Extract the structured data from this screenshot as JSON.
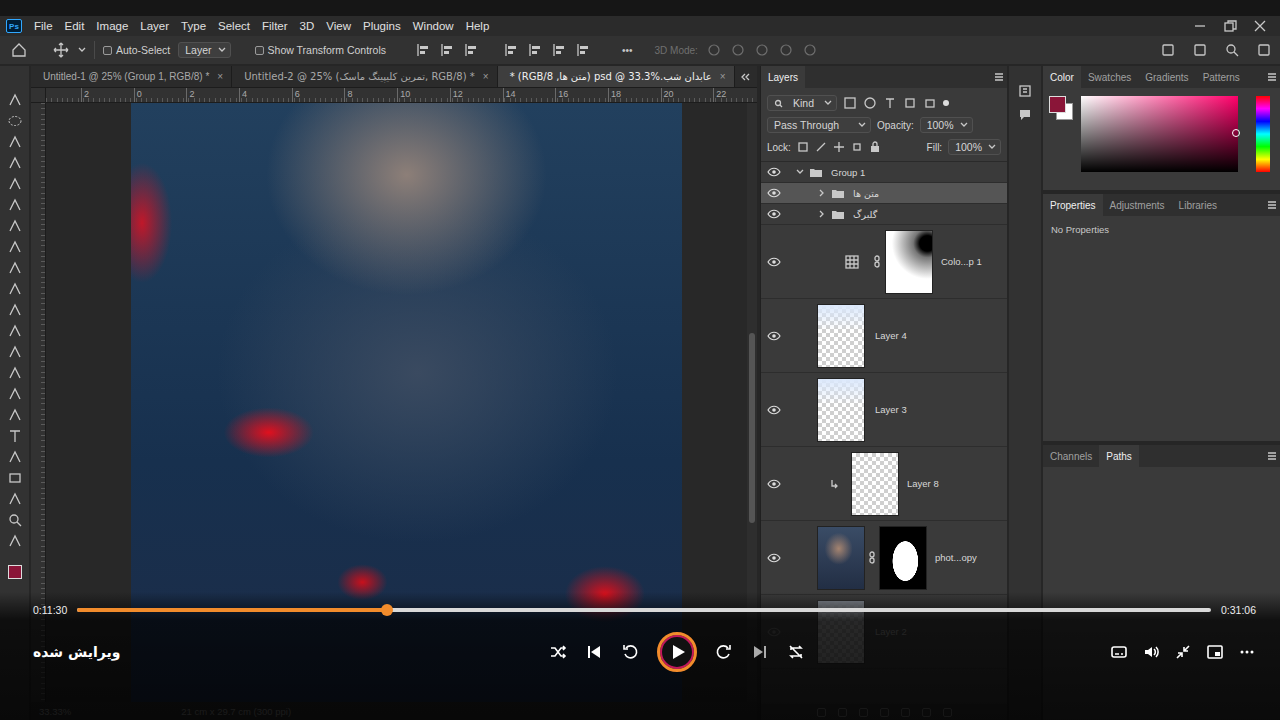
{
  "app": {
    "logo": "Ps"
  },
  "menu": [
    "File",
    "Edit",
    "Image",
    "Layer",
    "Type",
    "Select",
    "Filter",
    "3D",
    "View",
    "Plugins",
    "Window",
    "Help"
  ],
  "options": {
    "auto_select": {
      "label": "Auto-Select",
      "checked": false
    },
    "target": "Layer",
    "show_transform": {
      "label": "Show Transform Controls",
      "checked": false
    },
    "more": "•••",
    "mode_3d": "3D Mode:"
  },
  "tabs": [
    {
      "label": "Untitled-1 @ 25% (Group 1, RGB/8) *",
      "selected": false
    },
    {
      "label": "Untitled-2 @ 25% (تمرین کلیپینگ ماسک, RGB/8) *",
      "selected": false
    },
    {
      "label": "عابدان شب.psd @ 33.3% (متن ها, RGB/8) *",
      "selected": true
    }
  ],
  "tab_close": "×",
  "ruler": [
    "2",
    "0",
    "2",
    "4",
    "6",
    "8",
    "10",
    "12",
    "14",
    "16",
    "18",
    "20",
    "22"
  ],
  "layers_panel": {
    "title": "Layers",
    "filter": "Kind",
    "blend": "Pass Through",
    "opacity_label": "Opacity:",
    "opacity": "100%",
    "lock_label": "Lock:",
    "fill_label": "Fill:",
    "fill": "100%",
    "layers": [
      {
        "name": "Group 1",
        "kind": "group",
        "depth": 0,
        "visible": true,
        "expanded": true,
        "clipped": false,
        "selected": false
      },
      {
        "name": "متن ها",
        "kind": "group",
        "depth": 1,
        "visible": true,
        "expanded": false,
        "clipped": false,
        "selected": true
      },
      {
        "name": "گلبرگ",
        "kind": "group",
        "depth": 1,
        "visible": true,
        "expanded": false,
        "clipped": false,
        "selected": false
      },
      {
        "name": "Colo...p 1",
        "kind": "adjustment",
        "depth": 1,
        "visible": true,
        "expanded": false,
        "clipped": false,
        "selected": false
      },
      {
        "name": "Layer 4",
        "kind": "pixel",
        "depth": 1,
        "visible": true,
        "expanded": false,
        "clipped": false,
        "selected": false
      },
      {
        "name": "Layer 3",
        "kind": "pixel",
        "depth": 1,
        "visible": true,
        "expanded": false,
        "clipped": false,
        "selected": false
      },
      {
        "name": "Layer 8",
        "kind": "pixel",
        "depth": 1,
        "visible": true,
        "expanded": false,
        "clipped": true,
        "selected": false
      },
      {
        "name": "phot...opy",
        "kind": "masked",
        "depth": 1,
        "visible": true,
        "expanded": false,
        "clipped": false,
        "selected": false
      },
      {
        "name": "Layer 2",
        "kind": "pixel",
        "depth": 1,
        "visible": false,
        "expanded": false,
        "clipped": false,
        "selected": false
      }
    ]
  },
  "color_panel": {
    "tabs": [
      {
        "label": "Color",
        "selected": true
      },
      {
        "label": "Swatches",
        "selected": false
      },
      {
        "label": "Gradients",
        "selected": false
      },
      {
        "label": "Patterns",
        "selected": false
      }
    ],
    "foreground": "#8a1538"
  },
  "properties_panel": {
    "tabs": [
      {
        "label": "Properties",
        "selected": true
      },
      {
        "label": "Adjustments",
        "selected": false
      },
      {
        "label": "Libraries",
        "selected": false
      }
    ],
    "message": "No Properties"
  },
  "channels_panel": {
    "tabs": [
      {
        "label": "Channels",
        "selected": false
      },
      {
        "label": "Paths",
        "selected": true
      }
    ]
  },
  "status_bar": {
    "zoom": "33.33%",
    "size": "21 cm x 29.7 cm (300 ppi)"
  },
  "player": {
    "elapsed": "0:11:30",
    "duration": "0:31:06",
    "level": 0.273,
    "label": "ویرایش شده",
    "playing": false
  }
}
